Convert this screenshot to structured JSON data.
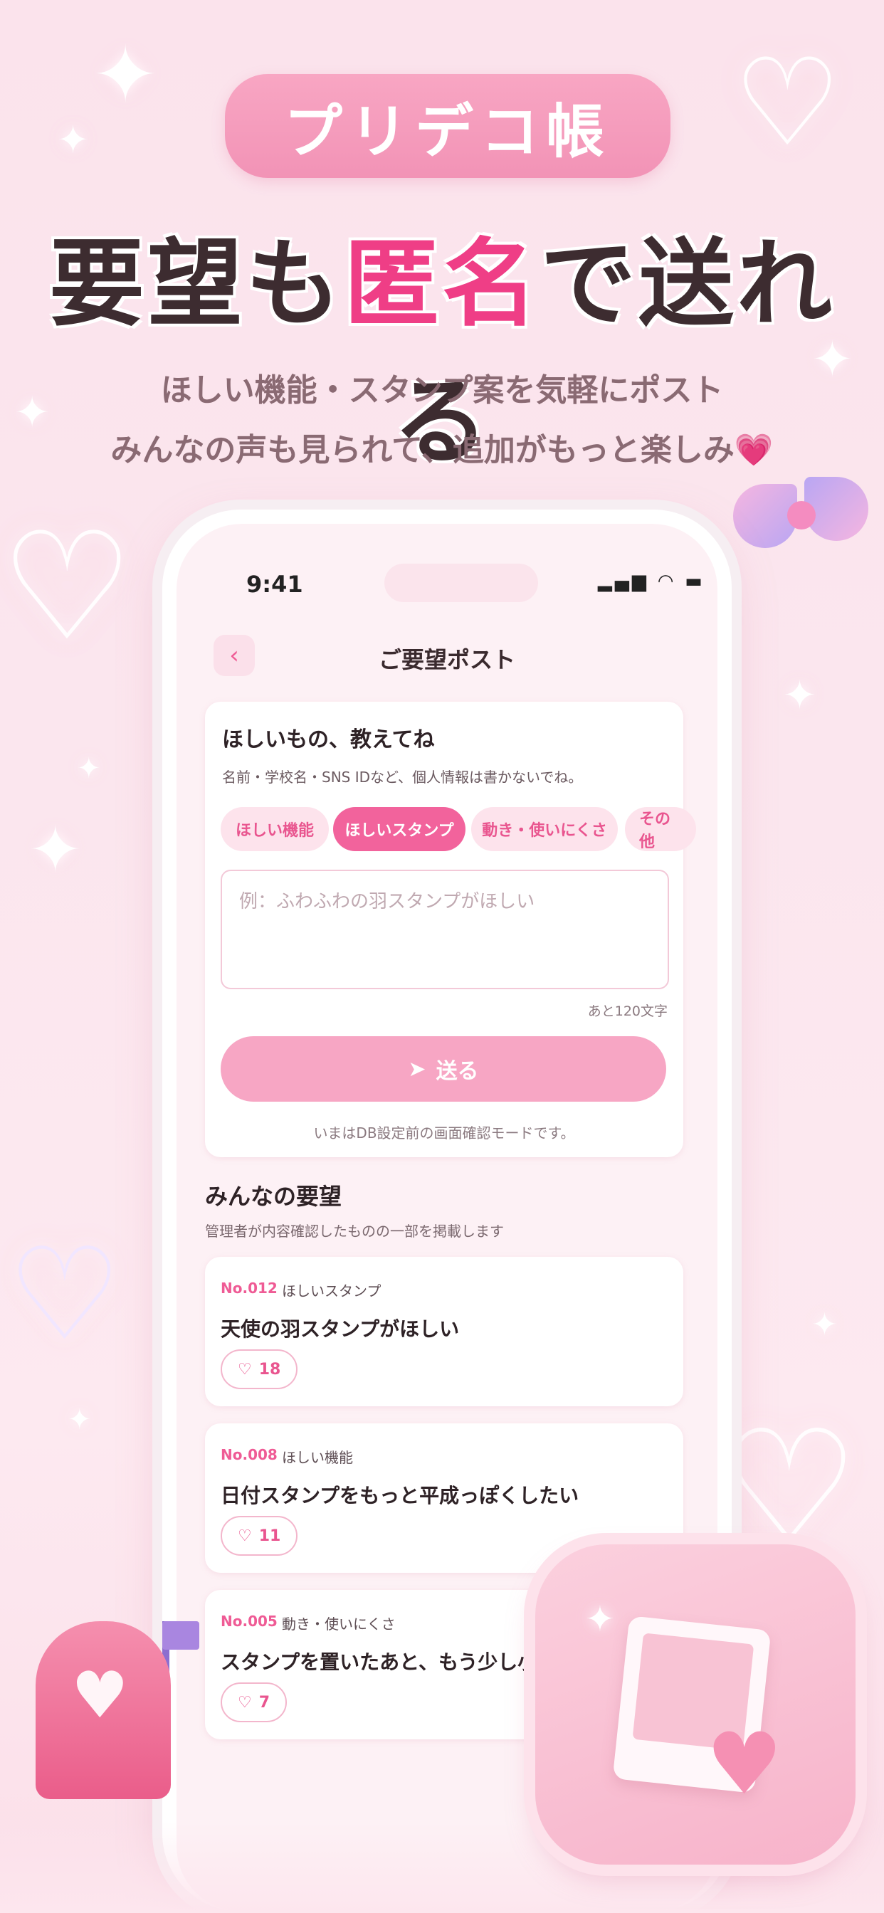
{
  "header": {
    "brand": "プリデコ帳",
    "headline_pre": "要望も",
    "headline_highlight": "匿名",
    "headline_post": "で送れる",
    "sub_line1": "ほしい機能・スタンプ案を気軽にポスト",
    "sub_line2": "みんなの声も見られて、追加がもっと楽しみ💗"
  },
  "status": {
    "time": "9:41"
  },
  "nav": {
    "back_icon": "chevron-left-icon",
    "title": "ご要望ポスト"
  },
  "form": {
    "title": "ほしいもの、教えてね",
    "note": "名前・学校名・SNS IDなど、個人情報は書かないでね。",
    "categories": [
      "ほしい機能",
      "ほしいスタンプ",
      "動き・使いにくさ",
      "その他"
    ],
    "selected_category": "ほしいスタンプ",
    "placeholder": "例：ふわふわの羽スタンプがほしい",
    "counter": "あと120文字",
    "send_label": "送る",
    "send_icon": "paper-plane-icon",
    "mode_note": "いまはDB設定前の画面確認モードです。"
  },
  "requests": {
    "title": "みんなの要望",
    "note": "管理者が内容確認したものの一部を掲載します",
    "items": [
      {
        "no": "No.012",
        "category": "ほしいスタンプ",
        "text": "天使の羽スタンプがほしい",
        "likes": "18"
      },
      {
        "no": "No.008",
        "category": "ほしい機能",
        "text": "日付スタンプをもっと平成っぽくしたい",
        "likes": "11"
      },
      {
        "no": "No.005",
        "category": "動き・使いにくさ",
        "text": "スタンプを置いたあと、もう少し小さく",
        "likes": "7"
      }
    ]
  },
  "colors": {
    "accent": "#ef3e86",
    "pink_light": "#fde3ec",
    "text_dark": "#2e2226"
  }
}
